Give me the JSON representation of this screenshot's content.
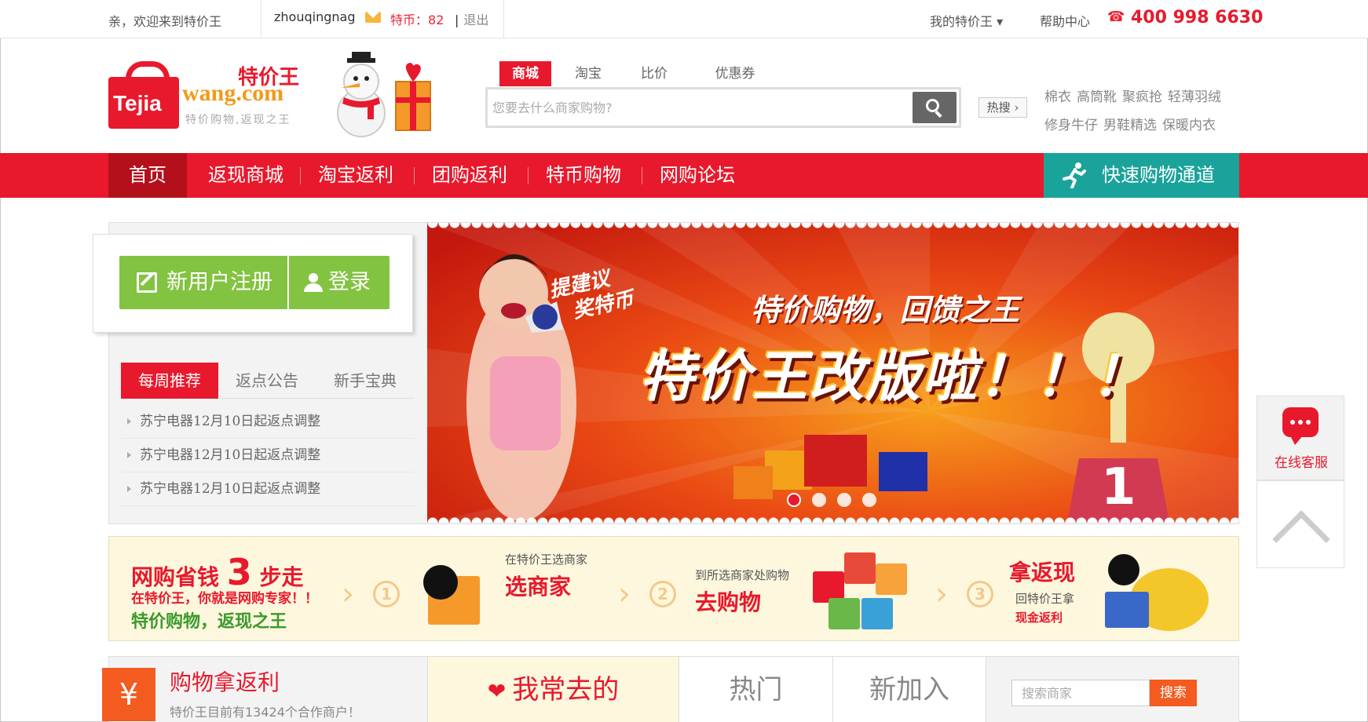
{
  "topbar": {
    "welcome": "亲，欢迎来到特价王",
    "username": "zhouqingnag",
    "coins_label": "特币：",
    "coins_value": "82",
    "separator": "|",
    "logout": "退出",
    "my_account": "我的特价王 ▾",
    "help": "帮助中心",
    "phone": "400 998 6630"
  },
  "logo": {
    "bag_text": "Tejia",
    "cn_name": "特价王",
    "domain": "wang.com",
    "slogan": "特价购物,返现之王"
  },
  "search": {
    "tabs": [
      "商城",
      "淘宝",
      "比价",
      "优惠券"
    ],
    "active_tab": "商城",
    "placeholder": "您要去什么商家购物?",
    "hot_label": "热搜",
    "hot_words": [
      "棉衣",
      "高筒靴",
      "聚疯抢",
      "轻薄羽绒",
      "修身牛仔",
      "男鞋精选",
      "保暖内衣"
    ]
  },
  "nav": {
    "items": [
      "首页",
      "返现商城",
      "淘宝返利",
      "团购返利",
      "特币购物",
      "网购论坛"
    ],
    "active": "首页",
    "fast_channel": "快速购物通道"
  },
  "account": {
    "register": "新用户注册",
    "login": "登录"
  },
  "notice": {
    "tabs": [
      "每周推荐",
      "返点公告",
      "新手宝典"
    ],
    "active_tab": "每周推荐",
    "items": [
      "苏宁电器12月10日起返点调整",
      "苏宁电器12月10日起返点调整",
      "苏宁电器12月10日起返点调整"
    ]
  },
  "banner": {
    "tip_line1": "提建议",
    "tip_line2": "奖特币",
    "subtitle": "特价购物，回馈之王",
    "headline": "特价王改版啦！！！",
    "podium_number": "1",
    "slide_count": 4,
    "active_slide": 1
  },
  "steps": {
    "title_prefix": "网购省钱",
    "title_num": "3",
    "title_suffix": "步走",
    "line2": "在特价王，你就是网购专家！！",
    "line3": "特价购物，返现之王",
    "step1_num": "1",
    "step1_small": "在特价王选商家",
    "step1_big": "选商家",
    "step2_num": "2",
    "step2_small": "到所选商家处购物",
    "step2_big": "去购物",
    "step3_num": "3",
    "step3_big": "拿返现",
    "step3_small1": "回特价王拿",
    "step3_small2": "现金返利"
  },
  "float": {
    "service": "在线客服"
  },
  "merchants": {
    "title": "购物拿返利",
    "subtitle": "特价王目前有13424个合作商户！",
    "yen": "¥",
    "tabs": [
      "我常去的",
      "热门",
      "新加入"
    ],
    "active_tab": "我常去的",
    "search_placeholder": "搜索商家",
    "search_button": "搜索"
  },
  "colors": {
    "brand_red": "#e8192c",
    "teal": "#1aa39a",
    "green": "#82c341",
    "orange": "#f35b20"
  }
}
